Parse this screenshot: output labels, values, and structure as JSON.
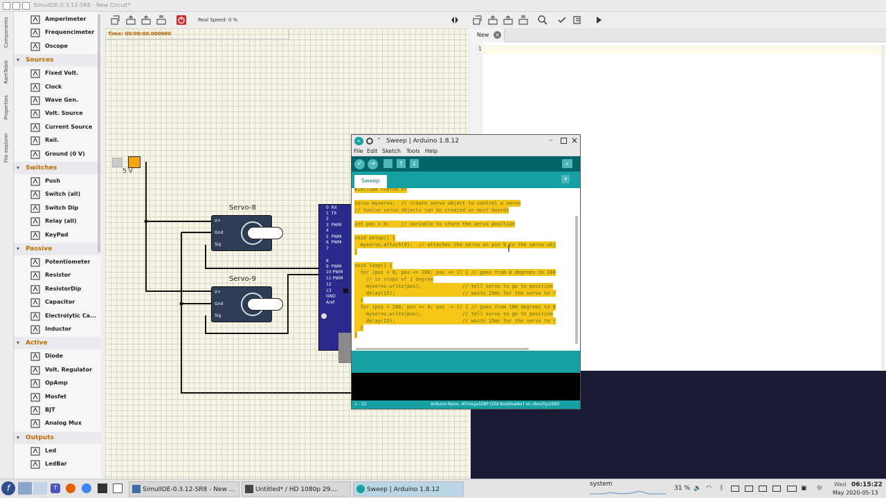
{
  "window": {
    "title": "SimulIDE-0.3.12-SR8 - New Circuit*"
  },
  "vertical_tabs": [
    "Components",
    "RamTable",
    "Properties",
    "File explorer"
  ],
  "components": {
    "top_items": [
      {
        "label": "Amperimeter",
        "icon": "ammeter-icon"
      },
      {
        "label": "Frequencimeter",
        "icon": "frequency-meter-icon"
      },
      {
        "label": "Oscope",
        "icon": "oscilloscope-icon"
      }
    ],
    "categories": [
      {
        "name": "Sources",
        "items": [
          {
            "label": "Fixed Volt.",
            "icon": "fixed-voltage-icon"
          },
          {
            "label": "Clock",
            "icon": "clock-icon"
          },
          {
            "label": "Wave Gen.",
            "icon": "wave-generator-icon"
          },
          {
            "label": "Volt. Source",
            "icon": "voltage-source-icon"
          },
          {
            "label": "Current Source",
            "icon": "current-source-icon"
          },
          {
            "label": "Rail.",
            "icon": "rail-icon"
          },
          {
            "label": "Ground (0 V)",
            "icon": "ground-icon"
          }
        ]
      },
      {
        "name": "Switches",
        "items": [
          {
            "label": "Push",
            "icon": "push-button-icon"
          },
          {
            "label": "Switch (all)",
            "icon": "switch-icon"
          },
          {
            "label": "Switch Dip",
            "icon": "switch-dip-icon"
          },
          {
            "label": "Relay (all)",
            "icon": "relay-icon"
          },
          {
            "label": "KeyPad",
            "icon": "keypad-icon"
          }
        ]
      },
      {
        "name": "Passive",
        "items": [
          {
            "label": "Potentiometer",
            "icon": "potentiometer-icon"
          },
          {
            "label": "Resistor",
            "icon": "resistor-icon"
          },
          {
            "label": "ResistorDip",
            "icon": "resistor-dip-icon"
          },
          {
            "label": "Capacitor",
            "icon": "capacitor-icon"
          },
          {
            "label": "Electrolytic Ca...",
            "icon": "electrolytic-capacitor-icon"
          },
          {
            "label": "Inductor",
            "icon": "inductor-icon"
          }
        ]
      },
      {
        "name": "Active",
        "items": [
          {
            "label": "Diode",
            "icon": "diode-icon"
          },
          {
            "label": "Volt. Regulator",
            "icon": "voltage-regulator-icon"
          },
          {
            "label": "OpAmp",
            "icon": "opamp-icon"
          },
          {
            "label": "Mosfet",
            "icon": "mosfet-icon"
          },
          {
            "label": "BJT",
            "icon": "bjt-icon"
          },
          {
            "label": "Analog Mux",
            "icon": "analog-mux-icon"
          }
        ]
      },
      {
        "name": "Outputs",
        "items": [
          {
            "label": "Led",
            "icon": "led-icon"
          },
          {
            "label": "LedBar",
            "icon": "ledbar-icon"
          }
        ]
      }
    ]
  },
  "circuit_toolbar": {
    "real_speed": "Real Speed: 0 %",
    "time": "Time: 00:00:00.000000"
  },
  "circuit": {
    "source_label": "5 V",
    "servo1": "Servo-8",
    "servo2": "Servo-9",
    "servo_pins": [
      "V+",
      "Gnd",
      "Sig"
    ],
    "nano_pins": [
      "0  RX",
      "1  TX",
      "2",
      "3  PWM",
      "4",
      "5  PWM",
      "6  PWM",
      "7",
      "8",
      "9  PWM",
      "10 PWM",
      "11 PWM",
      "12",
      "13",
      "GND",
      "Aref"
    ]
  },
  "editor": {
    "tab": "New",
    "line_number": "1"
  },
  "arduino": {
    "title": "Sweep | Arduino 1.8.12",
    "menu": [
      "File",
      "Edit",
      "Sketch",
      "Tools",
      "Help"
    ],
    "tab": "Sweep",
    "code": [
      "#include <Servo.h>",
      "",
      "Servo myservo;  // create servo object to control a servo",
      "// twelve servo objects can be created on most boards",
      "",
      "int pos = 0;    // variable to store the servo position",
      "",
      "void setup() {",
      "  myservo.attach(9);  // attaches the servo on pin 9 to the servo obj",
      "}",
      "",
      "void loop() {",
      "  for (pos = 0; pos <= 180; pos += 1) { // goes from 0 degrees to 180",
      "    // in steps of 1 degree",
      "    myservo.write(pos);              // tell servo to go to position",
      "    delay(15);                       // waits 15ms for the servo to r",
      "  }",
      "  for (pos = 180; pos >= 0; pos -= 1) { // goes from 180 degrees to 0",
      "    myservo.write(pos);              // tell servo to go to position",
      "    delay(15);                       // waits 15ms for the servo to r",
      "  }",
      "}"
    ],
    "footer_left": "1 - 32",
    "footer_right": "Arduino Nano, ATmega328P (Old Bootloader) on /dev/ttyUSB0"
  },
  "taskbar": {
    "tasks": [
      {
        "label": "SimulIDE-0.3.12-SR8 - New ...",
        "icon": "simulide-icon"
      },
      {
        "label": "Untitled* / HD 1080p 29....",
        "icon": "video-editor-icon"
      },
      {
        "label": "Sweep | Arduino 1.8.12",
        "icon": "arduino-icon"
      }
    ],
    "system_label": "system",
    "battery": "31 %",
    "day": "Wed",
    "time": "06:15:22",
    "date": "May 2020-05-13"
  }
}
